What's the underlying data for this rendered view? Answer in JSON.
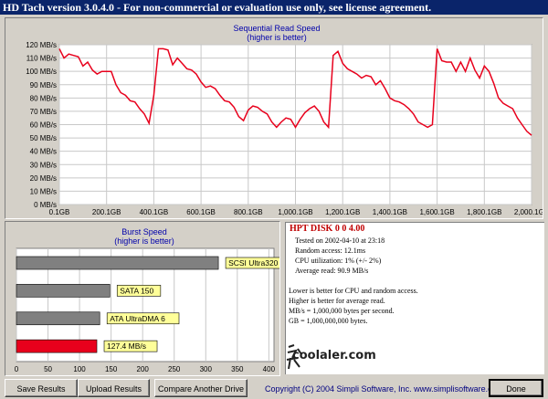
{
  "window": {
    "title": "HD Tach version 3.0.4.0  -  For non-commercial or evaluation use only, see license agreement."
  },
  "colors": {
    "titlebar": "#0a246a",
    "accent_red": "#e8001c",
    "chart_title": "#0000aa"
  },
  "seq_chart": {
    "title": "Sequential Read Speed",
    "subtitle": "(higher is better)",
    "y_ticks": [
      "0 MB/s",
      "10 MB/s",
      "20 MB/s",
      "30 MB/s",
      "40 MB/s",
      "50 MB/s",
      "60 MB/s",
      "70 MB/s",
      "80 MB/s",
      "90 MB/s",
      "100 MB/s",
      "110 MB/s",
      "120 MB/s"
    ],
    "x_ticks": [
      "0.1GB",
      "200.1GB",
      "400.1GB",
      "600.1GB",
      "800.1GB",
      "1,000.1GB",
      "1,200.1GB",
      "1,400.1GB",
      "1,600.1GB",
      "1,800.1GB",
      "2,000.1GB"
    ]
  },
  "burst_chart": {
    "title": "Burst Speed",
    "subtitle": "(higher is better)",
    "x_ticks": [
      "0",
      "50",
      "100",
      "150",
      "200",
      "250",
      "300",
      "350",
      "400"
    ]
  },
  "chart_data": [
    {
      "type": "line",
      "title": "Sequential Read Speed",
      "subtitle": "(higher is better)",
      "xlabel": "",
      "ylabel": "",
      "xlim": [
        0.1,
        2000.1
      ],
      "ylim": [
        0,
        120
      ],
      "grid": true,
      "series": [
        {
          "x": [
            0.1,
            20,
            40,
            60,
            80,
            100,
            120,
            140,
            160,
            180,
            200,
            220,
            240,
            260,
            280,
            300,
            320,
            340,
            360,
            380,
            400,
            420,
            440,
            460,
            480,
            500,
            520,
            540,
            560,
            580,
            600,
            620,
            640,
            660,
            680,
            700,
            720,
            740,
            760,
            780,
            800,
            820,
            840,
            860,
            880,
            900,
            920,
            940,
            960,
            980,
            1000,
            1020,
            1040,
            1060,
            1080,
            1100,
            1120,
            1140,
            1160,
            1180,
            1200,
            1220,
            1240,
            1260,
            1280,
            1300,
            1320,
            1340,
            1360,
            1380,
            1400,
            1420,
            1440,
            1460,
            1480,
            1500,
            1520,
            1540,
            1560,
            1580,
            1600,
            1620,
            1640,
            1660,
            1680,
            1700,
            1720,
            1740,
            1760,
            1780,
            1800,
            1820,
            1840,
            1860,
            1880,
            1900,
            1920,
            1940,
            1960,
            1980,
            2000.1
          ],
          "values": [
            117,
            110,
            113,
            112,
            111,
            104,
            107,
            101,
            98,
            100,
            100,
            100,
            90,
            84,
            82,
            78,
            77,
            72,
            68,
            61,
            82,
            117,
            117,
            116,
            105,
            110,
            106,
            102,
            101,
            98,
            92,
            88,
            89,
            87,
            82,
            78,
            77,
            73,
            66,
            63,
            71,
            74,
            73,
            70,
            68,
            62,
            58,
            62,
            65,
            64,
            58,
            64,
            69,
            72,
            74,
            70,
            62,
            58,
            112,
            115,
            106,
            102,
            100,
            98,
            95,
            97,
            96,
            90,
            93,
            87,
            80,
            78,
            77,
            75,
            72,
            68,
            62,
            60,
            58,
            60,
            117,
            108,
            107,
            107,
            100,
            107,
            100,
            110,
            101,
            95,
            104,
            100,
            91,
            80,
            76,
            74,
            72,
            65,
            60,
            55,
            52
          ]
        }
      ]
    },
    {
      "type": "bar",
      "title": "Burst Speed",
      "subtitle": "(higher is better)",
      "xlim": [
        0,
        400
      ],
      "categories": [
        "SCSI Ultra320",
        "SATA 150",
        "ATA UltraDMA 6",
        "127.4 MB/s"
      ],
      "values": [
        320,
        148,
        132,
        127.4
      ],
      "colors": [
        "#808080",
        "#808080",
        "#808080",
        "#e8001c"
      ]
    }
  ],
  "info": {
    "header": "HPT DISK 0 0 4.00",
    "lines": [
      "Tested on 2002-04-10 at 23:18",
      "Random access: 12.1ms",
      "CPU utilization: 1% (+/- 2%)",
      "Average read: 90.9 MB/s"
    ],
    "notes": [
      "Lower is better for CPU and random access.",
      "Higher is better for average read.",
      "MB/s = 1,000,000 bytes per second.",
      "GB = 1,000,000,000 bytes."
    ]
  },
  "buttons": {
    "save": "Save Results",
    "upload": "Upload Results",
    "compare": "Compare Another Drive",
    "done": "Done"
  },
  "footer": {
    "copyright": "Copyright (C) 2004 Simpli Software, Inc. www.simplisoftware.com",
    "watermark": "coolaler.com"
  }
}
